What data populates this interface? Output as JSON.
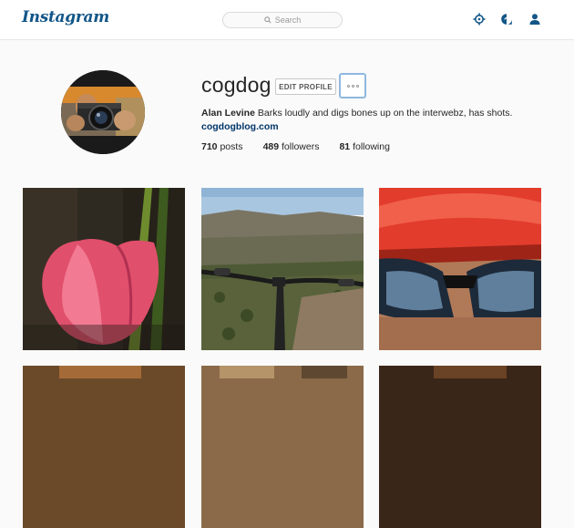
{
  "header": {
    "logo": "Instagram",
    "search_placeholder": "Search"
  },
  "icons": [
    "search-icon",
    "explore-compass-icon",
    "activity-icon",
    "profile-icon"
  ],
  "profile": {
    "username": "cogdog",
    "edit_button": "EDIT PROFILE",
    "full_name": "Alan Levine",
    "bio": "Barks loudly and digs bones up on the interwebz, has shots.",
    "website": "cogdogblog.com",
    "posts_count": "710",
    "posts_label": "posts",
    "followers_count": "489",
    "followers_label": "followers",
    "following_count": "81",
    "following_label": "following"
  },
  "colors": {
    "brand": "#125688",
    "link": "#003569",
    "focus_ring": "#8fb8e0"
  }
}
